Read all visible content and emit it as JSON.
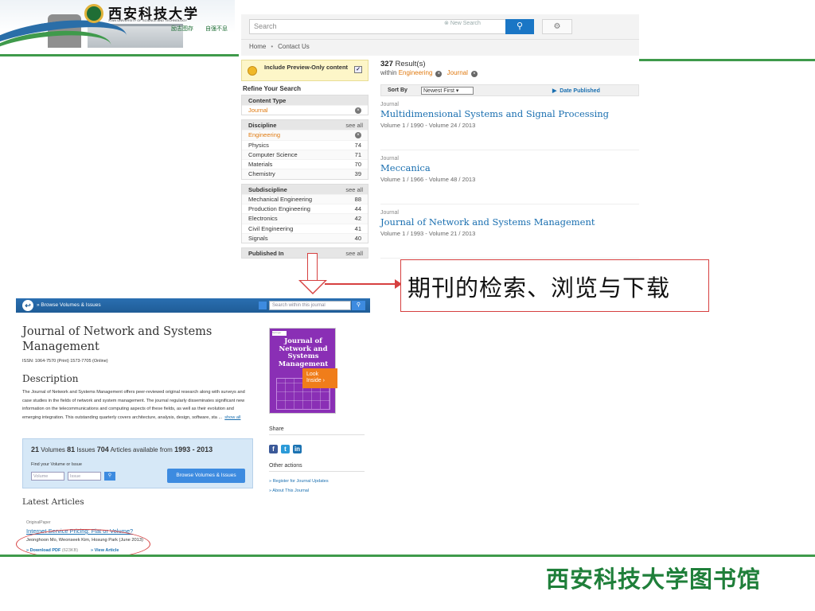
{
  "banner": {
    "university_name": "西安科技大学",
    "university_en": "XI'AN UNIVERSITY OF SCIENCE AND TECHNOLOGY",
    "motto_1": "励志图存",
    "motto_2": "自强不息"
  },
  "portal": {
    "search_placeholder": "Search",
    "new_search": "New Search",
    "search_icon": "magnifier-icon",
    "settings_icon": "gear-icon",
    "breadcrumb": [
      "Home",
      "Contact Us"
    ],
    "preview_label": "Include Preview-Only content",
    "refine_label": "Refine Your Search",
    "content_type": {
      "header": "Content Type",
      "selected": "Journal"
    },
    "discipline": {
      "header": "Discipline",
      "see_all": "see all",
      "selected": "Engineering",
      "items": [
        {
          "label": "Physics",
          "count": "74"
        },
        {
          "label": "Computer Science",
          "count": "71"
        },
        {
          "label": "Materials",
          "count": "70"
        },
        {
          "label": "Chemistry",
          "count": "39"
        }
      ]
    },
    "subdiscipline": {
      "header": "Subdiscipline",
      "see_all": "see all",
      "items": [
        {
          "label": "Mechanical Engineering",
          "count": "88"
        },
        {
          "label": "Production Engineering",
          "count": "44"
        },
        {
          "label": "Electronics",
          "count": "42"
        },
        {
          "label": "Civil Engineering",
          "count": "41"
        },
        {
          "label": "Signals",
          "count": "40"
        }
      ]
    },
    "published_in": {
      "header": "Published In",
      "see_all": "see all"
    },
    "results": {
      "count": "327",
      "count_label": "Result(s)",
      "within": "within",
      "filter_1": "Engineering",
      "filter_2": "Journal",
      "sort_by": "Sort By",
      "sort_value": "Newest First",
      "date_published": "Date Published",
      "items": [
        {
          "kind": "Journal",
          "title": "Multidimensional Systems and Signal Processing",
          "volumes": "Volume 1 / 1990 - Volume 24 / 2013"
        },
        {
          "kind": "Journal",
          "title": "Meccanica",
          "volumes": "Volume 1 / 1966 - Volume 48 / 2013"
        },
        {
          "kind": "Journal",
          "title": "Journal of Network and Systems Management",
          "volumes": "Volume 1 / 1993 - Volume 21 / 2013"
        }
      ]
    }
  },
  "callout": {
    "text": "期刊的检索、浏览与下载"
  },
  "journal": {
    "browse_label": "» Browse Volumes & Issues",
    "search_placeholder": "Search within this journal",
    "title": "Journal of Network and Systems Management",
    "issn": "ISSN: 1064-7570 (Print) 1573-7705 (Online)",
    "description_header": "Description",
    "description": "The Journal of Network and Systems Management offers peer-reviewed original research along with surveys and case studies in the fields of network and system management. The journal regularly disseminates significant new information on the telecommunications and computing aspects of these fields, as well as their evolution and emerging integration. This outstanding quarterly covers architecture, analysis, design, software, sta ...",
    "show_all": "show all",
    "volumes_num": "21",
    "volumes_label": "Volumes",
    "issues_num": "81",
    "issues_label": "Issues",
    "articles_num": "704",
    "articles_label": "Articles available from",
    "year_from": "1993",
    "year_sep": " - ",
    "year_to": "2013",
    "find_label": "Find your Volume or Issue",
    "volume_placeholder": "Volume",
    "issue_placeholder": "Issue",
    "browse_button": "Browse Volumes & Issues",
    "latest_header": "Latest Articles",
    "article": {
      "kind": "OriginalPaper",
      "title": "Internet Service Pricing: Flat or Volume?",
      "authors": "Jeonghoon Mo, Weonseek Kim, Hosung Park (June 2013)",
      "download": "» Download PDF",
      "size": "(623KB)",
      "view": "» View Article"
    },
    "cover": {
      "publisher": "Springer",
      "title": "Journal of Network and Systems Management",
      "look_inside": "Look Inside"
    },
    "share_label": "Share",
    "social": [
      "f",
      "t",
      "in"
    ],
    "other_actions": "Other actions",
    "link_1": "» Register for Journal Updates",
    "link_2": "» About This Journal"
  },
  "footer": {
    "text": "西安科技大学图书馆"
  },
  "colors": {
    "accent_green": "#3f9a4b",
    "link_blue": "#1a6fb0",
    "callout_red": "#d64040",
    "orange": "#e07a10"
  }
}
